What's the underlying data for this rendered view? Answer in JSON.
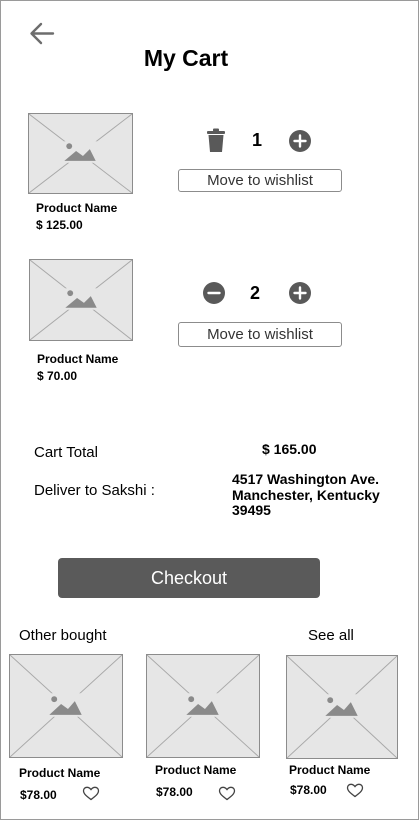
{
  "header": {
    "title": "My Cart"
  },
  "cart": {
    "items": [
      {
        "name": "Product Name",
        "price": "$ 125.00",
        "quantity": "1",
        "wishlist_label": "Move to wishlist"
      },
      {
        "name": "Product Name",
        "price": "$ 70.00",
        "quantity": "2",
        "wishlist_label": "Move to wishlist"
      }
    ],
    "total_label": "Cart Total",
    "total_value": "$ 165.00",
    "deliver_label": "Deliver to Sakshi :",
    "address": [
      "4517 Washington Ave.",
      "Manchester, Kentucky",
      "39495"
    ]
  },
  "checkout_label": "Checkout",
  "others": {
    "title": "Other bought",
    "see_all": "See all",
    "items": [
      {
        "name": "Product Name",
        "price": "$78.00"
      },
      {
        "name": "Product Name",
        "price": "$78.00"
      },
      {
        "name": "Product Name",
        "price": "$78.00"
      }
    ]
  },
  "colors": {
    "button_dark": "#5a5a5a",
    "placeholder_bg": "#e6e6e6",
    "icon_grey": "#595959"
  }
}
